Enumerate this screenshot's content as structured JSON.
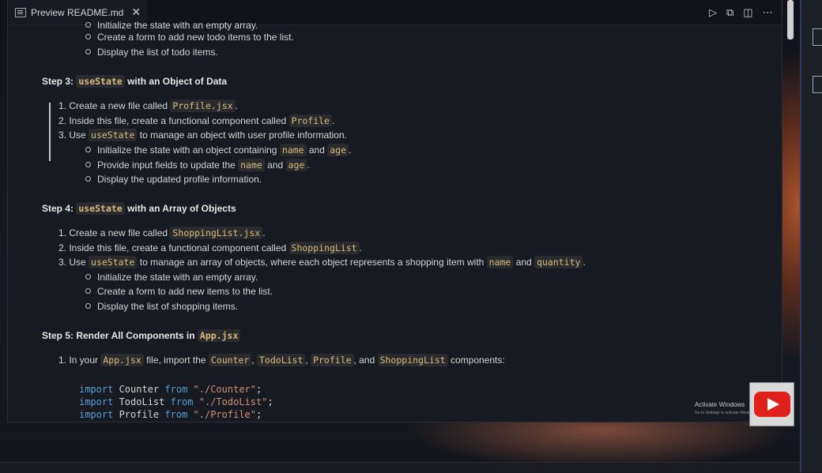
{
  "tab": {
    "title": "Preview README.md"
  },
  "actions": [
    "run",
    "open-changes",
    "split-editor",
    "more"
  ],
  "lines": [
    {
      "kind": "bullet",
      "text": "Initialize the state with an empty array."
    },
    {
      "kind": "bullet",
      "text": "Create a form to add new todo items to the list."
    },
    {
      "kind": "bullet",
      "text": "Display the list of todo items."
    },
    {
      "kind": "heading",
      "pre": "Step 3: ",
      "code": "useState",
      "post": " with an Object of Data"
    },
    {
      "kind": "num",
      "text": "1. Create a new file called ",
      "code": "Profile.jsx",
      "post": "."
    },
    {
      "kind": "num",
      "text": "2. Inside this file, create a functional component called ",
      "code": "Profile",
      "post": "."
    },
    {
      "kind": "num",
      "text": "3. Use ",
      "code": "useState",
      "post": " to manage an object with user profile information."
    },
    {
      "kind": "bullet",
      "text": "Initialize the state with an object containing ",
      "code": "name",
      "mid": " and ",
      "code2": "age",
      "post": "."
    },
    {
      "kind": "bullet",
      "text": "Provide input fields to update the ",
      "code": "name",
      "mid": " and ",
      "code2": "age",
      "post": "."
    },
    {
      "kind": "bullet",
      "text": "Display the updated profile information."
    },
    {
      "kind": "heading",
      "pre": "Step 4: ",
      "code": "useState",
      "post": " with an Array of Objects"
    },
    {
      "kind": "num",
      "text": "1. Create a new file called ",
      "code": "ShoppingList.jsx",
      "post": "."
    },
    {
      "kind": "num",
      "text": "2. Inside this file, create a functional component called ",
      "code": "ShoppingList",
      "post": "."
    },
    {
      "kind": "num",
      "text": "3. Use ",
      "code": "useState",
      "post": " to manage an array of objects, where each object represents a shopping item with ",
      "code2": "name",
      "mid2": " and ",
      "code3": "quantity",
      "post2": "."
    },
    {
      "kind": "bullet",
      "text": "Initialize the state with an empty array."
    },
    {
      "kind": "bullet",
      "text": "Create a form to add new items to the list."
    },
    {
      "kind": "bullet",
      "text": "Display the list of shopping items."
    },
    {
      "kind": "heading",
      "pre": "Step 5: Render All Components in ",
      "code": "App.jsx",
      "post": ""
    },
    {
      "kind": "num",
      "text": "1. In your ",
      "code": "App.jsx",
      "post": " file, import the ",
      "code2": "Counter",
      "s2": ", ",
      "code3": "TodoList",
      "s3": ", ",
      "code4": "Profile",
      "s4": ", and ",
      "code5": "ShoppingList",
      "s5": " components:"
    }
  ],
  "code_lines": [
    {
      "kw": "import",
      "name": " Counter ",
      "from": "from",
      "str": " \"./Counter\"",
      "end": ";"
    },
    {
      "kw": "import",
      "name": " TodoList ",
      "from": "from",
      "str": " \"./TodoList\"",
      "end": ";"
    },
    {
      "kw": "import",
      "name": " Profile ",
      "from": "from",
      "str": " \"./Profile\"",
      "end": ";"
    }
  ],
  "watermark": {
    "line1": "Activate Windows",
    "line2": "Go to Settings to activate Windows."
  }
}
